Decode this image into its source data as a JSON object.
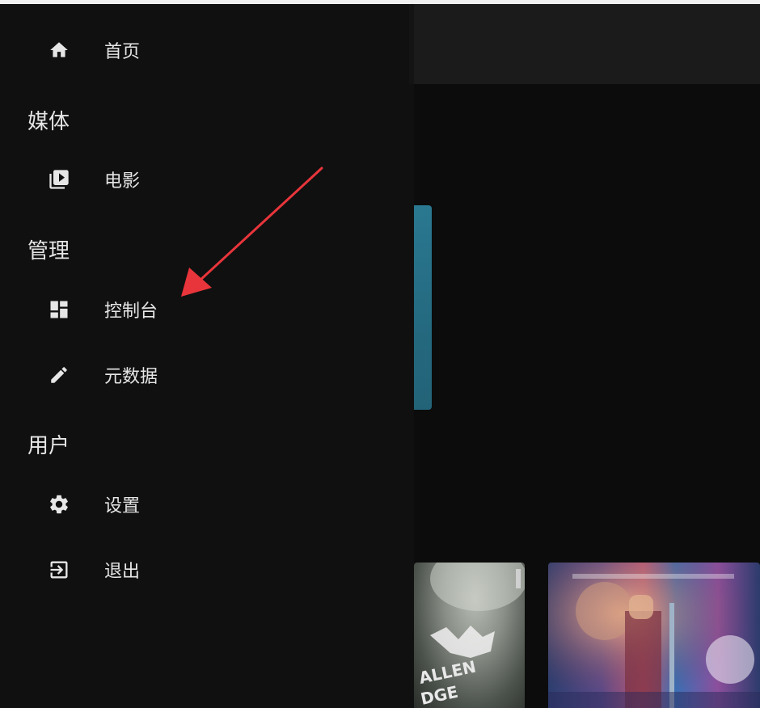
{
  "nav": {
    "home": {
      "label": "首页",
      "icon": "home-icon"
    },
    "sections": {
      "media": "媒体",
      "admin": "管理",
      "user": "用户"
    },
    "media_items": [
      {
        "label": "电影",
        "icon": "video-library-icon"
      }
    ],
    "admin_items": [
      {
        "label": "控制台",
        "icon": "dashboard-icon"
      },
      {
        "label": "元数据",
        "icon": "edit-pencil-icon"
      }
    ],
    "user_items": [
      {
        "label": "设置",
        "icon": "gear-icon"
      },
      {
        "label": "退出",
        "icon": "logout-icon"
      }
    ]
  },
  "colors": {
    "drawer_bg": "#101010",
    "text": "#e6e6e6",
    "annotation_arrow": "#e8353b",
    "accent_panel": "#2a7891"
  }
}
